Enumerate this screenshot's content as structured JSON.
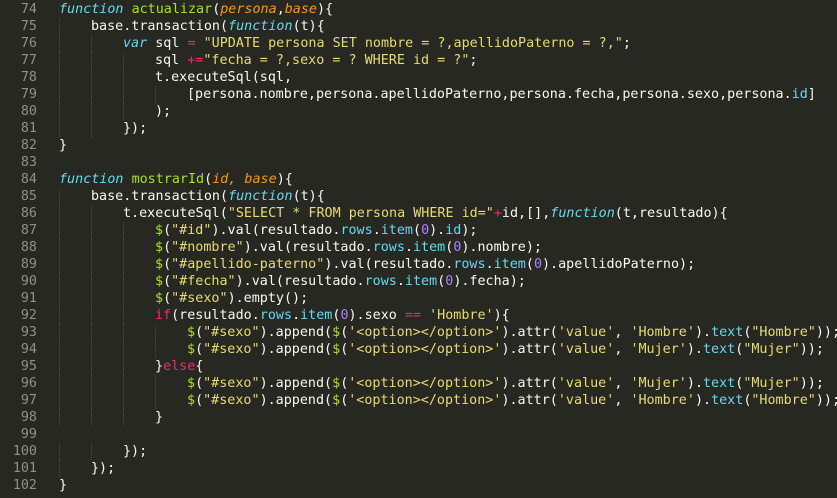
{
  "colors": {
    "background": "#272822",
    "line_number": "#8f908a",
    "keyword": "#66d9ef",
    "function_name": "#a6e22e",
    "parameter": "#fd971f",
    "string": "#e6db74",
    "operator": "#f92672",
    "number": "#ae81ff",
    "plain": "#f8f8f2"
  },
  "lines": [
    {
      "n": "74",
      "indent": 0,
      "tokens": [
        [
          "kw",
          "function"
        ],
        [
          "p",
          " "
        ],
        [
          "fn",
          "actualizar"
        ],
        [
          "p",
          "("
        ],
        [
          "par",
          "persona"
        ],
        [
          "p",
          ","
        ],
        [
          "par",
          "base"
        ],
        [
          "p",
          "){"
        ]
      ]
    },
    {
      "n": "75",
      "indent": 1,
      "tokens": [
        [
          "p",
          "base.transaction("
        ],
        [
          "kw",
          "function"
        ],
        [
          "p",
          "(t){"
        ]
      ]
    },
    {
      "n": "76",
      "indent": 2,
      "tokens": [
        [
          "kw",
          "var"
        ],
        [
          "p",
          " sql "
        ],
        [
          "op",
          "="
        ],
        [
          "p",
          " "
        ],
        [
          "str",
          "\"UPDATE persona SET nombre = ?,apellidoPaterno = ?,\""
        ],
        [
          "p",
          ";"
        ]
      ]
    },
    {
      "n": "77",
      "indent": 3,
      "tokens": [
        [
          "p",
          "sql "
        ],
        [
          "op",
          "+="
        ],
        [
          "str",
          "\"fecha = ?,sexo = ? WHERE id = ?\""
        ],
        [
          "p",
          ";"
        ]
      ]
    },
    {
      "n": "78",
      "indent": 3,
      "tokens": [
        [
          "p",
          "t.executeSql(sql,"
        ]
      ]
    },
    {
      "n": "79",
      "indent": 4,
      "tokens": [
        [
          "p",
          "[persona.nombre,persona.apellidoPaterno,persona.fecha,persona.sexo,persona."
        ],
        [
          "prop",
          "id"
        ],
        [
          "p",
          "]"
        ]
      ]
    },
    {
      "n": "80",
      "indent": 3,
      "tokens": [
        [
          "p",
          ");"
        ]
      ]
    },
    {
      "n": "81",
      "indent": 2,
      "tokens": [
        [
          "p",
          "});"
        ]
      ]
    },
    {
      "n": "82",
      "indent": 0,
      "tokens": [
        [
          "p",
          "}"
        ]
      ]
    },
    {
      "n": "83",
      "indent": 0,
      "tokens": []
    },
    {
      "n": "84",
      "indent": 0,
      "tokens": [
        [
          "kw",
          "function"
        ],
        [
          "p",
          " "
        ],
        [
          "fn",
          "mostrarId"
        ],
        [
          "p",
          "("
        ],
        [
          "par",
          "id, base"
        ],
        [
          "p",
          "){"
        ]
      ]
    },
    {
      "n": "85",
      "indent": 1,
      "tokens": [
        [
          "p",
          "base.transaction("
        ],
        [
          "kw",
          "function"
        ],
        [
          "p",
          "(t){"
        ]
      ]
    },
    {
      "n": "86",
      "indent": 2,
      "tokens": [
        [
          "p",
          "t.executeSql("
        ],
        [
          "str",
          "\"SELECT * FROM persona WHERE id=\""
        ],
        [
          "op",
          "+"
        ],
        [
          "p",
          "id,[],"
        ],
        [
          "kw",
          "function"
        ],
        [
          "p",
          "(t,resultado){"
        ]
      ]
    },
    {
      "n": "87",
      "indent": 3,
      "tokens": [
        [
          "fn",
          "$"
        ],
        [
          "p",
          "("
        ],
        [
          "str",
          "\"#id\""
        ],
        [
          "p",
          ").val(resultado."
        ],
        [
          "prop",
          "rows"
        ],
        [
          "p",
          "."
        ],
        [
          "prop",
          "item"
        ],
        [
          "p",
          "("
        ],
        [
          "num",
          "0"
        ],
        [
          "p",
          ")."
        ],
        [
          "prop",
          "id"
        ],
        [
          "p",
          ");"
        ]
      ]
    },
    {
      "n": "88",
      "indent": 3,
      "tokens": [
        [
          "fn",
          "$"
        ],
        [
          "p",
          "("
        ],
        [
          "str",
          "\"#nombre\""
        ],
        [
          "p",
          ").val(resultado."
        ],
        [
          "prop",
          "rows"
        ],
        [
          "p",
          "."
        ],
        [
          "prop",
          "item"
        ],
        [
          "p",
          "("
        ],
        [
          "num",
          "0"
        ],
        [
          "p",
          ").nombre);"
        ]
      ]
    },
    {
      "n": "89",
      "indent": 3,
      "tokens": [
        [
          "fn",
          "$"
        ],
        [
          "p",
          "("
        ],
        [
          "str",
          "\"#apellido-paterno\""
        ],
        [
          "p",
          ").val(resultado."
        ],
        [
          "prop",
          "rows"
        ],
        [
          "p",
          "."
        ],
        [
          "prop",
          "item"
        ],
        [
          "p",
          "("
        ],
        [
          "num",
          "0"
        ],
        [
          "p",
          ").apellidoPaterno);"
        ]
      ]
    },
    {
      "n": "90",
      "indent": 3,
      "tokens": [
        [
          "fn",
          "$"
        ],
        [
          "p",
          "("
        ],
        [
          "str",
          "\"#fecha\""
        ],
        [
          "p",
          ").val(resultado."
        ],
        [
          "prop",
          "rows"
        ],
        [
          "p",
          "."
        ],
        [
          "prop",
          "item"
        ],
        [
          "p",
          "("
        ],
        [
          "num",
          "0"
        ],
        [
          "p",
          ").fecha);"
        ]
      ]
    },
    {
      "n": "91",
      "indent": 3,
      "tokens": [
        [
          "fn",
          "$"
        ],
        [
          "p",
          "("
        ],
        [
          "str",
          "\"#sexo\""
        ],
        [
          "p",
          ").empty();"
        ]
      ]
    },
    {
      "n": "92",
      "indent": 3,
      "tokens": [
        [
          "op",
          "if"
        ],
        [
          "p",
          "(resultado."
        ],
        [
          "prop",
          "rows"
        ],
        [
          "p",
          "."
        ],
        [
          "prop",
          "item"
        ],
        [
          "p",
          "("
        ],
        [
          "num",
          "0"
        ],
        [
          "p",
          ").sexo "
        ],
        [
          "op",
          "=="
        ],
        [
          "p",
          " "
        ],
        [
          "str",
          "'Hombre'"
        ],
        [
          "p",
          "){"
        ]
      ]
    },
    {
      "n": "93",
      "indent": 4,
      "tokens": [
        [
          "fn",
          "$"
        ],
        [
          "p",
          "("
        ],
        [
          "str",
          "\"#sexo\""
        ],
        [
          "p",
          ").append("
        ],
        [
          "fn",
          "$"
        ],
        [
          "p",
          "("
        ],
        [
          "str",
          "'<option></option>'"
        ],
        [
          "p",
          ").attr("
        ],
        [
          "str",
          "'value'"
        ],
        [
          "p",
          ", "
        ],
        [
          "str",
          "'Hombre'"
        ],
        [
          "p",
          ")."
        ],
        [
          "prop",
          "text"
        ],
        [
          "p",
          "("
        ],
        [
          "str",
          "\"Hombre\""
        ],
        [
          "p",
          "));"
        ]
      ]
    },
    {
      "n": "94",
      "indent": 4,
      "tokens": [
        [
          "fn",
          "$"
        ],
        [
          "p",
          "("
        ],
        [
          "str",
          "\"#sexo\""
        ],
        [
          "p",
          ").append("
        ],
        [
          "fn",
          "$"
        ],
        [
          "p",
          "("
        ],
        [
          "str",
          "'<option></option>'"
        ],
        [
          "p",
          ").attr("
        ],
        [
          "str",
          "'value'"
        ],
        [
          "p",
          ", "
        ],
        [
          "str",
          "'Mujer'"
        ],
        [
          "p",
          ")."
        ],
        [
          "prop",
          "text"
        ],
        [
          "p",
          "("
        ],
        [
          "str",
          "\"Mujer\""
        ],
        [
          "p",
          "));"
        ]
      ]
    },
    {
      "n": "95",
      "indent": 3,
      "tokens": [
        [
          "p",
          "}"
        ],
        [
          "op",
          "else"
        ],
        [
          "p",
          "{"
        ]
      ]
    },
    {
      "n": "96",
      "indent": 4,
      "tokens": [
        [
          "fn",
          "$"
        ],
        [
          "p",
          "("
        ],
        [
          "str",
          "\"#sexo\""
        ],
        [
          "p",
          ").append("
        ],
        [
          "fn",
          "$"
        ],
        [
          "p",
          "("
        ],
        [
          "str",
          "'<option></option>'"
        ],
        [
          "p",
          ").attr("
        ],
        [
          "str",
          "'value'"
        ],
        [
          "p",
          ", "
        ],
        [
          "str",
          "'Mujer'"
        ],
        [
          "p",
          ")."
        ],
        [
          "prop",
          "text"
        ],
        [
          "p",
          "("
        ],
        [
          "str",
          "\"Mujer\""
        ],
        [
          "p",
          "));"
        ]
      ]
    },
    {
      "n": "97",
      "indent": 4,
      "tokens": [
        [
          "fn",
          "$"
        ],
        [
          "p",
          "("
        ],
        [
          "str",
          "\"#sexo\""
        ],
        [
          "p",
          ").append("
        ],
        [
          "fn",
          "$"
        ],
        [
          "p",
          "("
        ],
        [
          "str",
          "'<option></option>'"
        ],
        [
          "p",
          ").attr("
        ],
        [
          "str",
          "'value'"
        ],
        [
          "p",
          ", "
        ],
        [
          "str",
          "'Hombre'"
        ],
        [
          "p",
          ")."
        ],
        [
          "prop",
          "text"
        ],
        [
          "p",
          "("
        ],
        [
          "str",
          "\"Hombre\""
        ],
        [
          "p",
          "));"
        ]
      ]
    },
    {
      "n": "98",
      "indent": 3,
      "tokens": [
        [
          "p",
          "}"
        ]
      ]
    },
    {
      "n": "99",
      "indent": 0,
      "tokens": []
    },
    {
      "n": "100",
      "indent": 2,
      "tokens": [
        [
          "p",
          "});"
        ]
      ]
    },
    {
      "n": "101",
      "indent": 1,
      "tokens": [
        [
          "p",
          "});"
        ]
      ]
    },
    {
      "n": "102",
      "indent": 0,
      "tokens": [
        [
          "p",
          "}"
        ]
      ]
    }
  ]
}
